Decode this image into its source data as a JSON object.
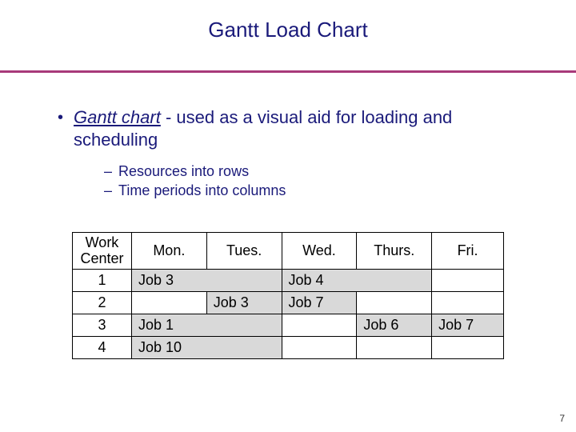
{
  "title": "Gantt Load Chart",
  "bullet": {
    "term": "Gantt chart",
    "rest": " - used as a visual aid for loading and scheduling"
  },
  "sub": {
    "a": "Resources into rows",
    "b": "Time periods into columns"
  },
  "table": {
    "header": {
      "rowhead": "Work\nCenter",
      "c1": "Mon.",
      "c2": "Tues.",
      "c3": "Wed.",
      "c4": "Thurs.",
      "c5": "Fri."
    },
    "rows": {
      "r1": {
        "head": "1",
        "mon": "Job 3",
        "wed": "Job 4"
      },
      "r2": {
        "head": "2",
        "tues": "Job 3",
        "wed": "Job 7"
      },
      "r3": {
        "head": "3",
        "mon": "Job 1",
        "thurs": "Job 6",
        "fri": "Job 7"
      },
      "r4": {
        "head": "4",
        "mon": "Job 10"
      }
    }
  },
  "chart_data": {
    "type": "table",
    "title": "Gantt Load Chart",
    "columns": [
      "Work Center",
      "Mon.",
      "Tues.",
      "Wed.",
      "Thurs.",
      "Fri."
    ],
    "rows": [
      {
        "work_center": 1,
        "jobs": [
          {
            "label": "Job 3",
            "span": [
              "Mon.",
              "Tues."
            ]
          },
          {
            "label": "Job 4",
            "span": [
              "Wed.",
              "Thurs."
            ]
          }
        ]
      },
      {
        "work_center": 2,
        "jobs": [
          {
            "label": "Job 3",
            "span": [
              "Tues."
            ]
          },
          {
            "label": "Job 7",
            "span": [
              "Wed."
            ]
          }
        ]
      },
      {
        "work_center": 3,
        "jobs": [
          {
            "label": "Job 1",
            "span": [
              "Mon.",
              "Tues."
            ]
          },
          {
            "label": "Job 6",
            "span": [
              "Thurs."
            ]
          },
          {
            "label": "Job 7",
            "span": [
              "Fri."
            ]
          }
        ]
      },
      {
        "work_center": 4,
        "jobs": [
          {
            "label": "Job 10",
            "span": [
              "Mon.",
              "Tues."
            ]
          }
        ]
      }
    ]
  },
  "pagenum": "7"
}
